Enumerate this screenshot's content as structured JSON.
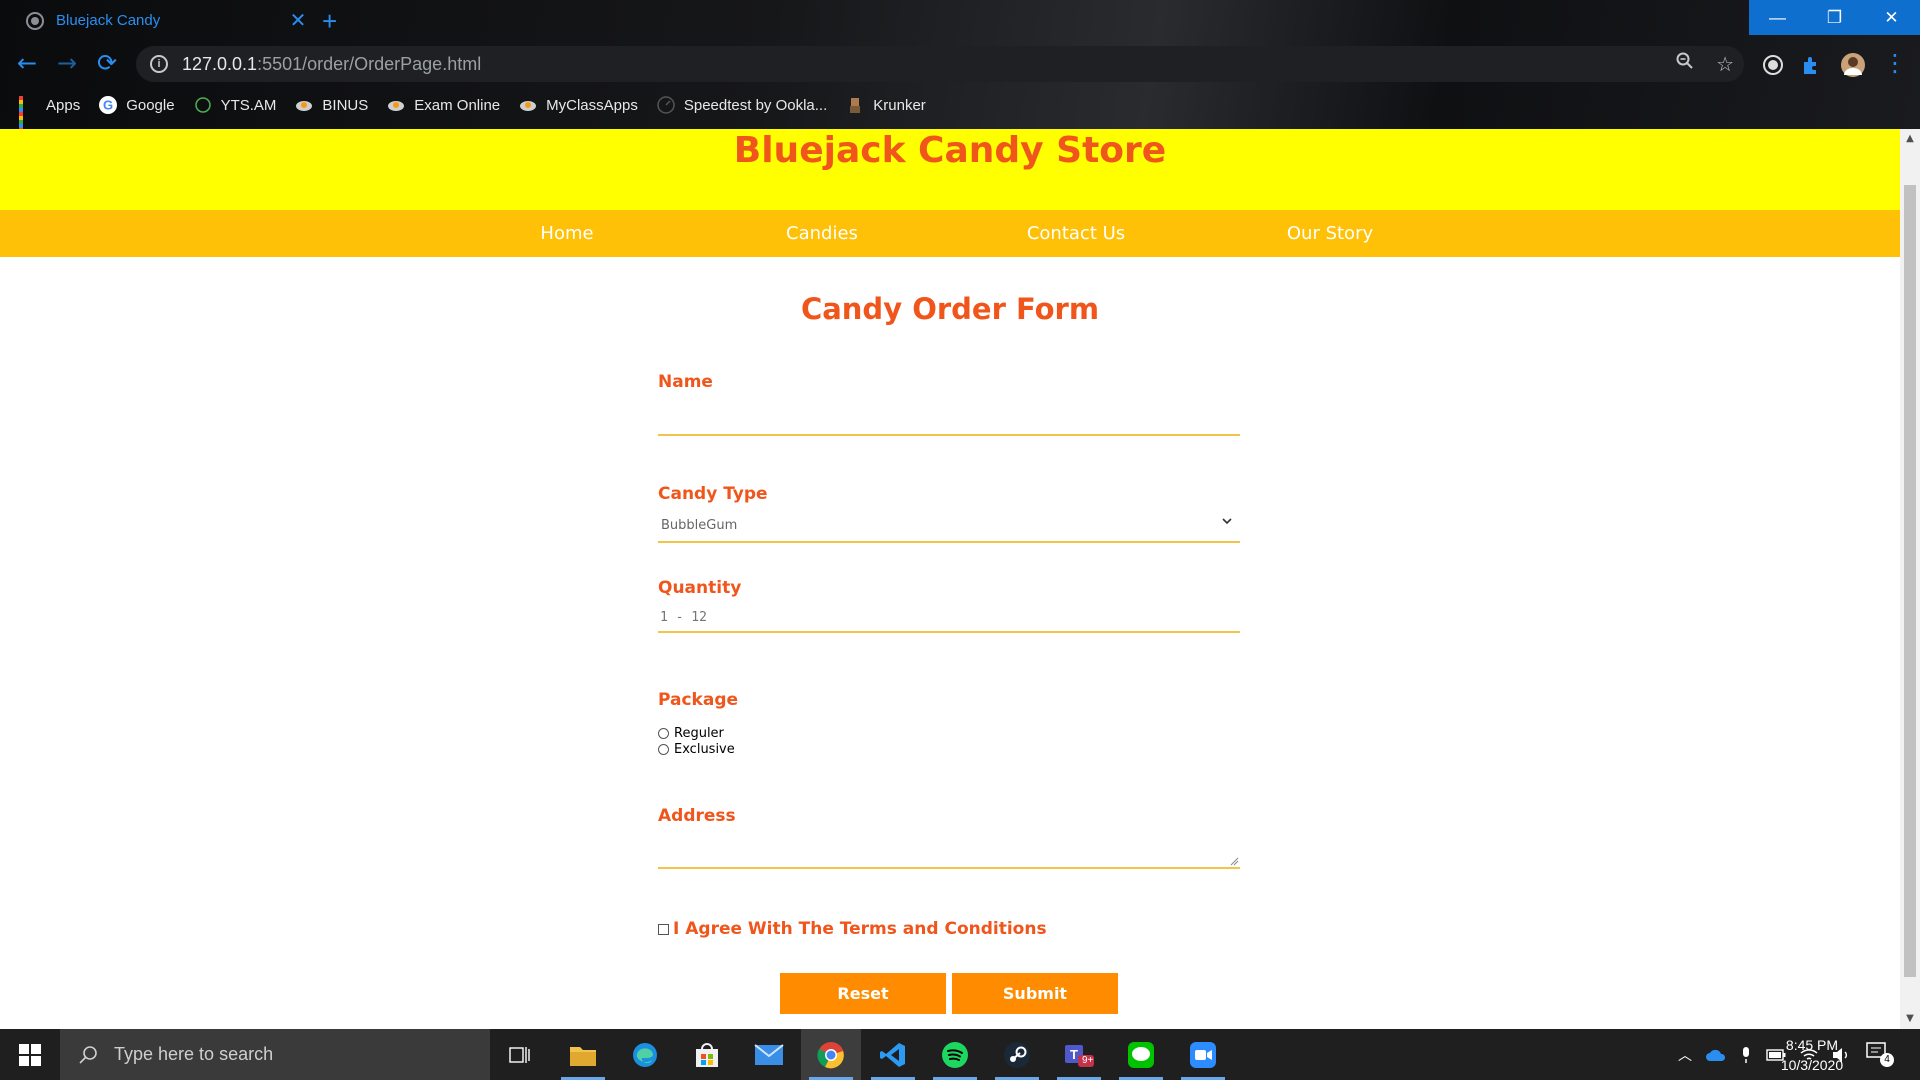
{
  "browser": {
    "tab_title": "Bluejack Candy",
    "url_host": "127.0.0.1",
    "url_path": ":5501/order/OrderPage.html",
    "bookmarks": [
      "Apps",
      "Google",
      "YTS.AM",
      "BINUS",
      "Exam Online",
      "MyClassApps",
      "Speedtest by Ookla...",
      "Krunker"
    ]
  },
  "site": {
    "title": "Bluejack Candy Store",
    "nav": [
      "Home",
      "Candies",
      "Contact Us",
      "Our Story"
    ]
  },
  "form": {
    "title": "Candy Order Form",
    "name_label": "Name",
    "name_value": "",
    "candy_label": "Candy Type",
    "candy_selected": "BubbleGum",
    "qty_label": "Quantity",
    "qty_placeholder": "1 - 12",
    "package_label": "Package",
    "package_options": [
      "Reguler",
      "Exclusive"
    ],
    "address_label": "Address",
    "agree_label": "I Agree With The Terms and Conditions",
    "reset_label": "Reset",
    "submit_label": "Submit"
  },
  "taskbar": {
    "search_placeholder": "Type here to search",
    "time": "8:45 PM",
    "date": "10/3/2020",
    "teams_badge": "9+",
    "notification_count": "4"
  },
  "colors": {
    "accent": "#f0561b",
    "header_bg": "#ffff00",
    "nav_bg": "#ffc107",
    "button_bg": "#ff8c00",
    "input_underline": "#f2c44a"
  }
}
